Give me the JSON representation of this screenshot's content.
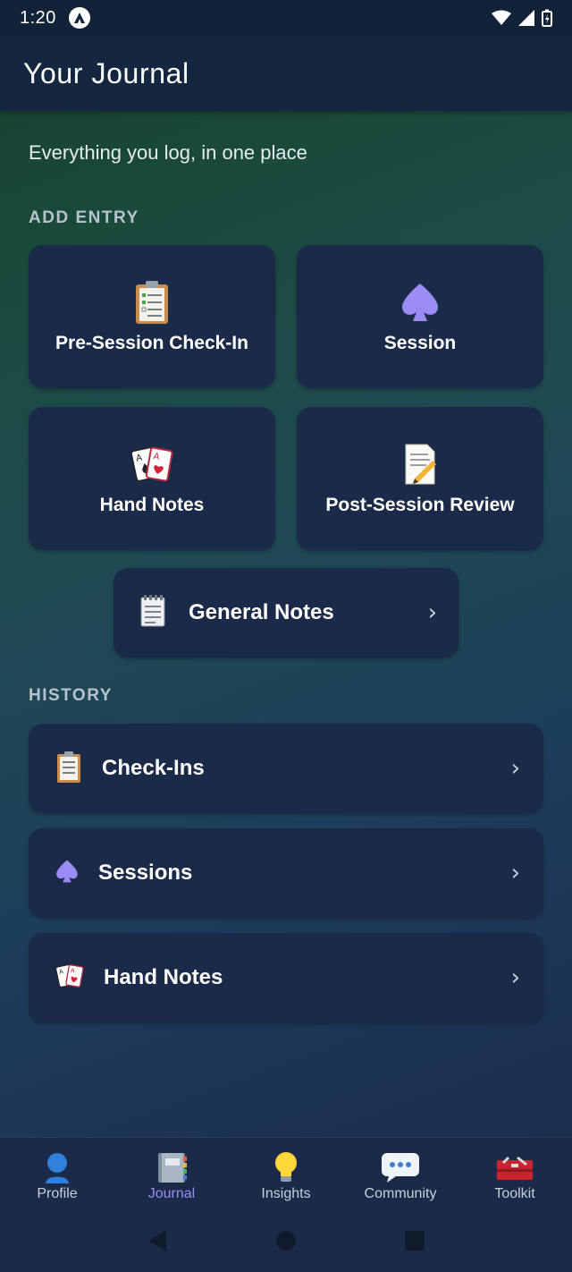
{
  "status": {
    "time": "1:20"
  },
  "header": {
    "title": "Your Journal"
  },
  "subtitle": "Everything you log, in one place",
  "add_entry": {
    "label": "ADD ENTRY",
    "tiles": [
      {
        "label": "Pre-Session Check-In",
        "icon": "clipboard-icon"
      },
      {
        "label": "Session",
        "icon": "spade-icon"
      },
      {
        "label": "Hand Notes",
        "icon": "playing-cards-icon"
      },
      {
        "label": "Post-Session Review",
        "icon": "memo-icon"
      }
    ],
    "general": {
      "label": "General Notes",
      "icon": "notepad-icon"
    }
  },
  "history": {
    "label": "HISTORY",
    "items": [
      {
        "label": "Check-Ins",
        "icon": "clipboard-icon"
      },
      {
        "label": "Sessions",
        "icon": "spade-icon"
      },
      {
        "label": "Hand Notes",
        "icon": "playing-cards-icon"
      }
    ]
  },
  "nav": {
    "items": [
      {
        "label": "Profile",
        "icon": "profile-icon"
      },
      {
        "label": "Journal",
        "icon": "journal-icon",
        "active": true
      },
      {
        "label": "Insights",
        "icon": "lightbulb-icon"
      },
      {
        "label": "Community",
        "icon": "speech-bubble-icon"
      },
      {
        "label": "Toolkit",
        "icon": "toolbox-icon"
      }
    ]
  },
  "colors": {
    "accent": "#9b8cf5",
    "card": "#1b2a48",
    "header": "#142640"
  }
}
